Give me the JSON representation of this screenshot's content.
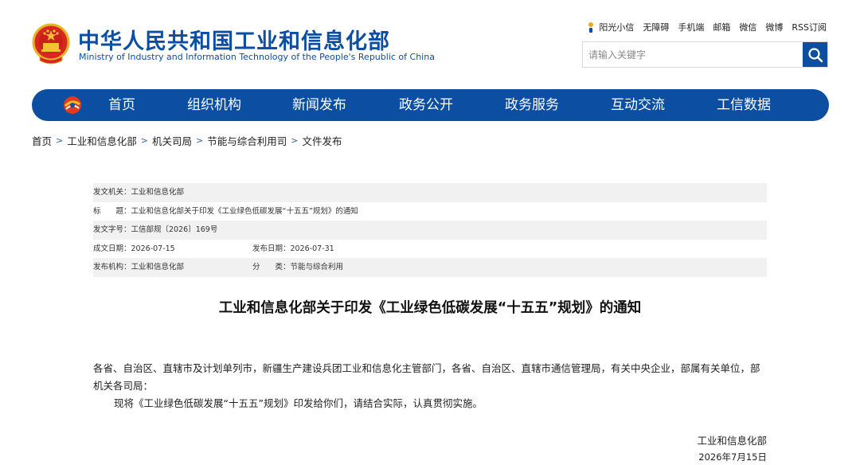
{
  "header": {
    "title_cn": "中华人民共和国工业和信息化部",
    "title_en": "Ministry of Industry and Information Technology of the People's Republic of China",
    "top_links": [
      "阳光小信",
      "无障碍",
      "手机端",
      "邮箱",
      "微信",
      "微博",
      "RSS订阅"
    ],
    "search_placeholder": "请输入关键字",
    "search_icon": "search-icon",
    "brand_color": "#0b4ea2"
  },
  "nav": {
    "items": [
      "首页",
      "组织机构",
      "新闻发布",
      "政务公开",
      "政务服务",
      "互动交流",
      "工信数据"
    ]
  },
  "breadcrumb": {
    "items": [
      "首页",
      "工业和信息化部",
      "机关司局",
      "节能与综合利用司",
      "文件发布"
    ],
    "separator": ">"
  },
  "meta": {
    "issuer_label": "发文机关：",
    "issuer_value": "工业和信息化部",
    "title_label": "标　　题：",
    "title_value": "工业和信息化部关于印发《工业绿色低碳发展“十五五”规划》的通知",
    "docno_label": "发文字号：",
    "docno_value": "工信部规〔2026〕169号",
    "created_label": "成文日期：",
    "created_value": "2026-07-15",
    "published_label": "发布日期：",
    "published_value": "2026-07-31",
    "agency_label": "发布机构：",
    "agency_value": "工业和信息化部",
    "category_label": "分　　类：",
    "category_value": "节能与综合利用"
  },
  "document": {
    "title": "工业和信息化部关于印发《工业绿色低碳发展“十五五”规划》的通知",
    "recipients": "各省、自治区、直辖市及计划单列市，新疆生产建设兵团工业和信息化主管部门，各省、自治区、直辖市通信管理局，有关中央企业，部属有关单位，部机关各司局：",
    "body": "现将《工业绿色低碳发展“十五五”规划》印发给你们，请结合实际，认真贯彻实施。",
    "signature_org": "工业和信息化部",
    "signature_date": "2026年7月15日"
  }
}
